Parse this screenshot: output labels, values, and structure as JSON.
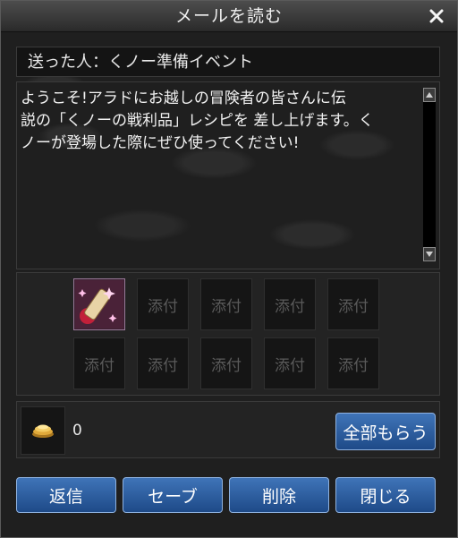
{
  "window": {
    "title": "メールを読む"
  },
  "mail": {
    "sender_label": "送った人：",
    "sender_name": "くノー準備イベント",
    "body": "ようこそ!アラドにお越しの冒険者の皆さんに伝\n説の「くノーの戦利品」レシピを 差し上げます。く\nノーが登場した際にぜひ使ってください!"
  },
  "attachments": {
    "slot_label": "添付",
    "slots": [
      {
        "filled": true,
        "label": ""
      },
      {
        "filled": false,
        "label": "添付"
      },
      {
        "filled": false,
        "label": "添付"
      },
      {
        "filled": false,
        "label": "添付"
      },
      {
        "filled": false,
        "label": "添付"
      },
      {
        "filled": false,
        "label": "添付"
      },
      {
        "filled": false,
        "label": "添付"
      },
      {
        "filled": false,
        "label": "添付"
      },
      {
        "filled": false,
        "label": "添付"
      },
      {
        "filled": false,
        "label": "添付"
      }
    ]
  },
  "gold": {
    "amount": "0"
  },
  "buttons": {
    "receive_all": "全部もらう",
    "reply": "返信",
    "save": "セーブ",
    "delete": "削除",
    "close": "閉じる"
  },
  "colors": {
    "button_blue": "#2a5ca0",
    "frame": "#5a5a5a"
  },
  "icons": {
    "close": "close-icon",
    "scroll_up": "scroll-up-icon",
    "scroll_down": "scroll-down-icon",
    "gold": "gold-coins-icon",
    "item": "recipe-scroll-icon"
  }
}
